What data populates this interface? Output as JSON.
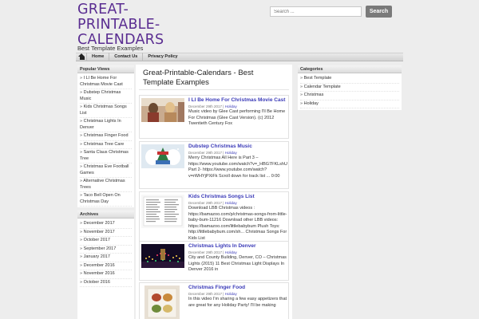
{
  "site": {
    "title": "GREAT-PRINTABLE-CALENDARS",
    "description": "Best Template Examples"
  },
  "search": {
    "placeholder": "Search ...",
    "button": "Search"
  },
  "nav": {
    "items": [
      "Home",
      "Contact Us",
      "Privacy Policy"
    ]
  },
  "popular": {
    "title": "Popular Views",
    "items": [
      "I Ll Be Home For Christmas Movie Cast",
      "Dubstep Christmas Music",
      "Kids Christmas Songs List",
      "Christmas Lights In Denver",
      "Christmas Finger Food",
      "Christmas Tree Care",
      "Santa Claus Christmas Tree",
      "Christmas Eve Football Games",
      "Alternative Christmas Trees",
      "Taco Bell Open On Christmas Day"
    ]
  },
  "archives": {
    "title": "Archives",
    "items": [
      "December 2017",
      "November 2017",
      "October 2017",
      "September 2017",
      "January 2017",
      "December 2016",
      "November 2016",
      "October 2016"
    ]
  },
  "categories": {
    "title": "Categories",
    "items": [
      "Best Template",
      "Calendar Template",
      "Christmas",
      "Holiday"
    ]
  },
  "main": {
    "title": "Great-Printable-Calendars - Best Template Examples",
    "posts": [
      {
        "title": "I Ll Be Home For Christmas Movie Cast",
        "date": "December 29th 2017",
        "category": "Holiday",
        "excerpt": "Music video by Glee Cast performing I'll Be Home For Christmas (Glee Cast Version). (c) 2012 Twentieth Century Fox"
      },
      {
        "title": "Dubstep Christmas Music",
        "date": "December 29th 2017",
        "category": "Holiday",
        "excerpt": "Merry Christmas All Here is Part 3 – https://www.youtube.com/watch?v=_HBG7FKLshU Part 2- https://www.youtube.com/watch?v=rWHYjPXiFk Scroll down for track list ... 0:00"
      },
      {
        "title": "Kids Christmas Songs List",
        "date": "December 29th 2017",
        "category": "Holiday",
        "excerpt": "Download LBB Christmas videos : https://bamazoo.com/p/christmas-songs-from-little-baby-bum-11216 Download other LBB videos: https://bamazoo.com/littlebabybum Plush Toys: http://littlebabybum.com/sh... Christmas Songs For Kids List"
      },
      {
        "title": "Christmas Lights In Denver",
        "date": "December 29th 2017",
        "category": "Holiday",
        "excerpt": "City and County Building, Denver, CO – Christmas Lights (2015) 11 Best Christmas Light Displays In Denver 2016 in"
      },
      {
        "title": "Christmas Finger Food",
        "date": "December 29th 2017",
        "category": "Holiday",
        "excerpt": "In this video I'm sharing a few easy appetizers that are great for any Holiday Party! I'll be making"
      }
    ]
  }
}
